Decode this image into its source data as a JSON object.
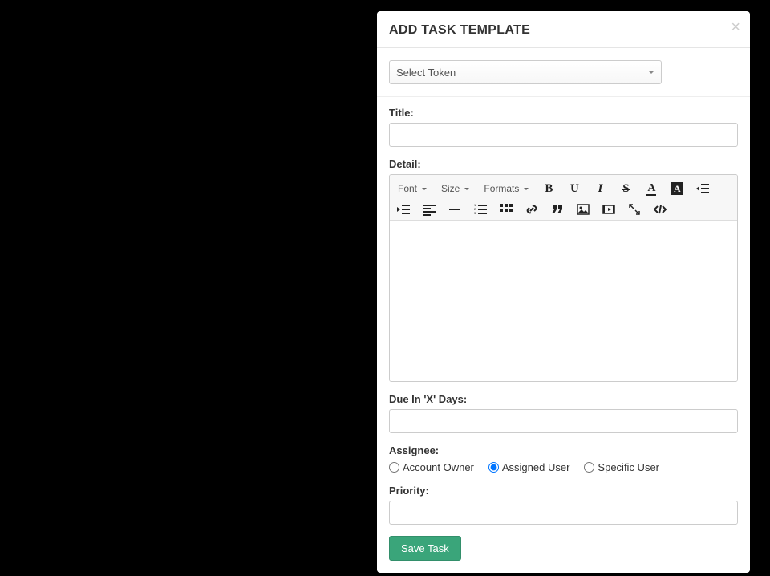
{
  "modal": {
    "title": "ADD TASK TEMPLATE",
    "close": "×"
  },
  "token": {
    "placeholder": "Select Token"
  },
  "fields": {
    "title_label": "Title:",
    "detail_label": "Detail:",
    "due_label": "Due In 'X' Days:",
    "assignee_label": "Assignee:",
    "priority_label": "Priority:"
  },
  "editor": {
    "font": "Font",
    "size": "Size",
    "formats": "Formats"
  },
  "assignee": {
    "options": [
      {
        "label": "Account Owner",
        "checked": false
      },
      {
        "label": "Assigned User",
        "checked": true
      },
      {
        "label": "Specific User",
        "checked": false
      }
    ]
  },
  "buttons": {
    "save": "Save Task"
  }
}
